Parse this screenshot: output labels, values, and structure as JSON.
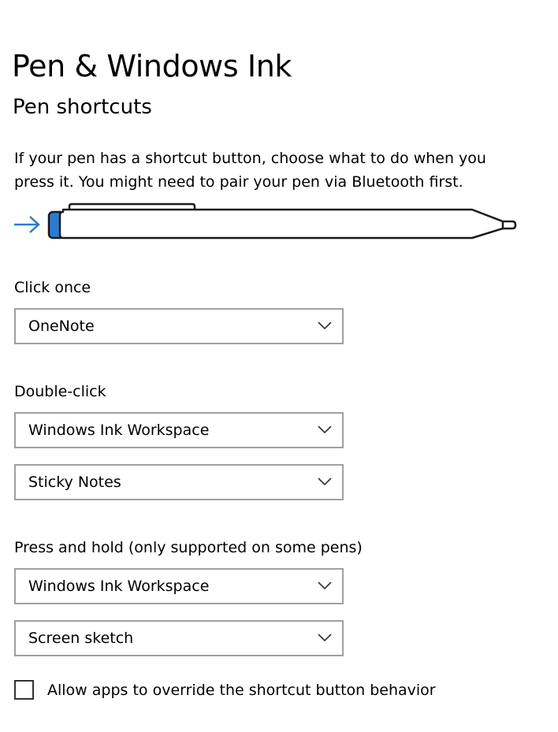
{
  "page": {
    "title": "Pen & Windows Ink",
    "section_title": "Pen shortcuts",
    "description_line1": "If your pen has a shortcut button, choose what to do when you",
    "description_line2": "press it. You might need to pair your pen via Bluetooth first."
  },
  "illustration": {
    "arrow_icon": "arrow-right-icon",
    "pen_icon": "pen-icon",
    "accent_color": "#2b7cd3",
    "button_color": "#2b7cd3"
  },
  "click_once": {
    "label": "Click once",
    "selected": "OneNote"
  },
  "double_click": {
    "label": "Double-click",
    "primary_selected": "Windows Ink Workspace",
    "secondary_selected": "Sticky Notes"
  },
  "press_and_hold": {
    "label": "Press and hold (only supported on some pens)",
    "primary_selected": "Windows Ink Workspace",
    "secondary_selected": "Screen sketch"
  },
  "override": {
    "label": "Allow apps to override the shortcut button behavior",
    "checked": false
  },
  "icons": {
    "dropdown": "chevron-down-icon",
    "checkbox": "checkbox-unchecked-icon"
  }
}
